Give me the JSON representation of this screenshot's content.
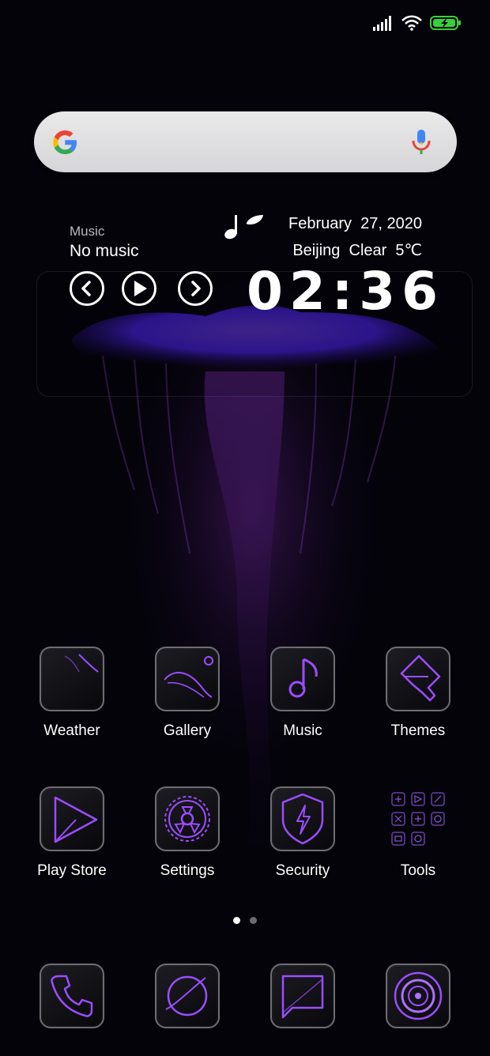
{
  "status_bar": {
    "signal_icon": "signal-bars-icon",
    "wifi_icon": "wifi-icon",
    "battery_icon": "battery-charging-icon",
    "battery_color": "#36d13a"
  },
  "search": {
    "logo_icon": "google-logo-icon",
    "mic_icon": "microphone-icon"
  },
  "music_widget": {
    "label": "Music",
    "title": "No music",
    "prev_icon": "chevron-left-icon",
    "play_icon": "play-icon",
    "next_icon": "chevron-right-icon",
    "note_icon": "music-note-icon"
  },
  "clock_widget": {
    "date": "February  27, 2020",
    "weather": "Beijing  Clear  5℃",
    "time": "02:36"
  },
  "apps": [
    {
      "label": "Weather",
      "icon": "weather-icon"
    },
    {
      "label": "Gallery",
      "icon": "gallery-icon"
    },
    {
      "label": "Music",
      "icon": "music-icon"
    },
    {
      "label": "Themes",
      "icon": "themes-brush-icon"
    },
    {
      "label": "Play Store",
      "icon": "play-store-icon"
    },
    {
      "label": "Settings",
      "icon": "settings-gear-icon"
    },
    {
      "label": "Security",
      "icon": "security-shield-icon"
    },
    {
      "label": "Tools",
      "icon": "tools-folder-icon"
    }
  ],
  "dock": [
    {
      "icon": "phone-icon"
    },
    {
      "icon": "browser-planet-icon"
    },
    {
      "icon": "messages-icon"
    },
    {
      "icon": "camera-icon"
    }
  ],
  "page_indicator": {
    "count": 2,
    "active": 1
  },
  "colors": {
    "accent": "#8a3cf0",
    "icon_stroke": "#9b4dff",
    "tile_border": "#6d6d73",
    "background": "#04030a"
  }
}
